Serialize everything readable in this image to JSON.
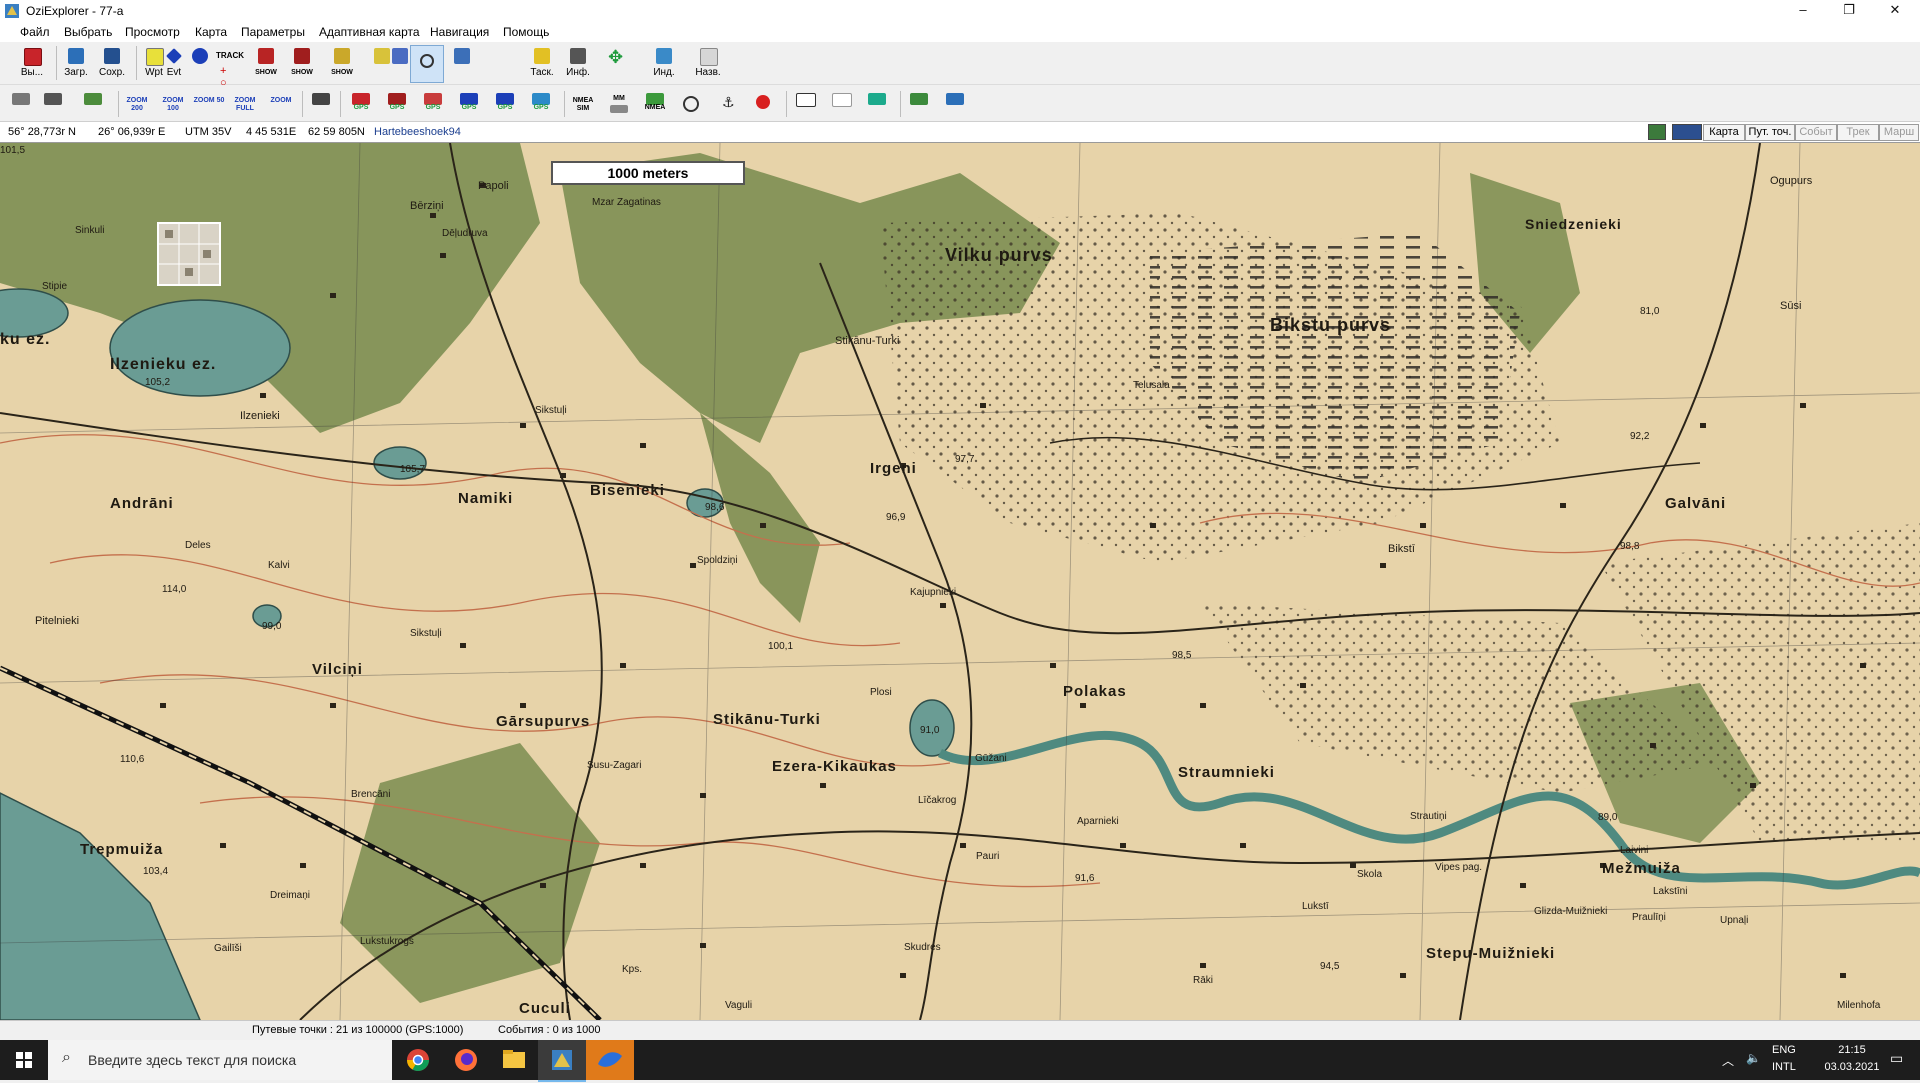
{
  "window": {
    "title": "OziExplorer - 77-a",
    "controls": {
      "minimize": "–",
      "maximize": "❐",
      "close": "✕"
    }
  },
  "menu": [
    "Файл",
    "Выбрать",
    "Просмотр",
    "Карта",
    "Параметры",
    "Адаптивная карта",
    "Навигация",
    "Помощь"
  ],
  "toolbar1": {
    "exit_label": "Вы...",
    "load_label": "Загр.",
    "save_label": "Сохр.",
    "wpt_label": "Wpt",
    "evt_label": "Evt",
    "track_label": "TRACK",
    "show1_label": "SHOW",
    "show2_label": "SHOW",
    "show3_label": "SHOW",
    "zoom_value": "50",
    "task_label": "Таск.",
    "info_label": "Инф.",
    "ind_label": "Инд.",
    "name_label": "Назв."
  },
  "toolbar2": {
    "zoom200": "ZOOM 200",
    "zoom100": "ZOOM 100",
    "zoom50": "ZOOM 50",
    "zoomfull": "ZOOM FULL",
    "zoom": "ZOOM",
    "gps": "GPS",
    "nmea": "NMEA SIM",
    "mm": "MM",
    "nmea2": "NMEA"
  },
  "inforow": {
    "lat": "56° 28,773r N",
    "lon": "26° 06,939r E",
    "utm": "UTM  35V",
    "easting": "4 45 531E",
    "northing": "62 59 805N",
    "datum": "Hartebeeshoek94",
    "tabs": [
      "Карта",
      "Пут. точ.",
      "Событ",
      "Трек",
      "Марш"
    ]
  },
  "map": {
    "scale_label": "1000 meters",
    "labels": [
      {
        "t": "Papoli",
        "s": 11,
        "b": false
      },
      {
        "t": "Mzar Zagatinas",
        "s": 10,
        "b": false
      },
      {
        "t": "Bērziņi",
        "s": 11,
        "b": false
      },
      {
        "t": "Sinkuli",
        "s": 10,
        "b": false
      },
      {
        "t": "Dēļudruva",
        "s": 10,
        "b": false
      },
      {
        "t": "Vilku purvs",
        "s": 18,
        "b": true
      },
      {
        "t": "Sniedzenieki",
        "s": 14,
        "b": true
      },
      {
        "t": "Bikstu purvs",
        "s": 18,
        "b": true
      },
      {
        "t": "Ogupurs",
        "s": 11,
        "b": false
      },
      {
        "t": "Ilzenieku ez.",
        "s": 16,
        "b": true
      },
      {
        "t": "ku ez.",
        "s": 16,
        "b": true
      },
      {
        "t": "Ilzenieki",
        "s": 11,
        "b": false
      },
      {
        "t": "Stikānu-Turki",
        "s": 11,
        "b": false
      },
      {
        "t": "Telusala",
        "s": 10,
        "b": false
      },
      {
        "t": "Sūsi",
        "s": 11,
        "b": false
      },
      {
        "t": "Sikstuļi",
        "s": 10,
        "b": false
      },
      {
        "t": "Irgeni",
        "s": 15,
        "b": true
      },
      {
        "t": "Namiki",
        "s": 15,
        "b": true
      },
      {
        "t": "Bisenieki",
        "s": 15,
        "b": true
      },
      {
        "t": "Andrāni",
        "s": 15,
        "b": true
      },
      {
        "t": "Galvāni",
        "s": 15,
        "b": true
      },
      {
        "t": "Deles",
        "s": 10,
        "b": false
      },
      {
        "t": "Spoldziņi",
        "s": 10,
        "b": false
      },
      {
        "t": "Bikstī",
        "s": 11,
        "b": false
      },
      {
        "t": "Kalvi",
        "s": 10,
        "b": false
      },
      {
        "t": "Kajupnieki",
        "s": 10,
        "b": false
      },
      {
        "t": "Pitelnieki",
        "s": 11,
        "b": false
      },
      {
        "t": "Vilciņi",
        "s": 15,
        "b": true
      },
      {
        "t": "Sikstuļi",
        "s": 10,
        "b": false
      },
      {
        "t": "Polakas",
        "s": 15,
        "b": true
      },
      {
        "t": "Plosi",
        "s": 10,
        "b": false
      },
      {
        "t": "Gārsupurvs",
        "s": 15,
        "b": true
      },
      {
        "t": "Stikānu-Turki",
        "s": 15,
        "b": true
      },
      {
        "t": "Ezera-Kikaukas",
        "s": 15,
        "b": true
      },
      {
        "t": "Straumnieki",
        "s": 15,
        "b": true
      },
      {
        "t": "Susu-Zagari",
        "s": 10,
        "b": false
      },
      {
        "t": "Gūžani",
        "s": 10,
        "b": false
      },
      {
        "t": "Brencāni",
        "s": 10,
        "b": false
      },
      {
        "t": "Līčakrog",
        "s": 10,
        "b": false
      },
      {
        "t": "Aparnieki",
        "s": 10,
        "b": false
      },
      {
        "t": "Strautiņi",
        "s": 10,
        "b": false
      },
      {
        "t": "Mežmuiža",
        "s": 15,
        "b": true
      },
      {
        "t": "Trepmuiža",
        "s": 15,
        "b": true
      },
      {
        "t": "Pauri",
        "s": 10,
        "b": false
      },
      {
        "t": "Vipes pag.",
        "s": 10,
        "b": false
      },
      {
        "t": "Laivini",
        "s": 10,
        "b": false
      },
      {
        "t": "Dreimaņi",
        "s": 10,
        "b": false
      },
      {
        "t": "Skola",
        "s": 10,
        "b": false
      },
      {
        "t": "Lakstīni",
        "s": 10,
        "b": false
      },
      {
        "t": "Lukstī",
        "s": 10,
        "b": false
      },
      {
        "t": "Glizda-Muižnieki",
        "s": 10,
        "b": false
      },
      {
        "t": "Praulīņi",
        "s": 10,
        "b": false
      },
      {
        "t": "Upnaļi",
        "s": 10,
        "b": false
      },
      {
        "t": "Lukstukrogs",
        "s": 10,
        "b": false
      },
      {
        "t": "Skudres",
        "s": 10,
        "b": false
      },
      {
        "t": "Stepu-Muižnieki",
        "s": 15,
        "b": true
      },
      {
        "t": "Gailīši",
        "s": 10,
        "b": false
      },
      {
        "t": "Kps.",
        "s": 10,
        "b": false
      },
      {
        "t": "Rāki",
        "s": 10,
        "b": false
      },
      {
        "t": "Cuculi",
        "s": 15,
        "b": true
      },
      {
        "t": "Vaguli",
        "s": 10,
        "b": false
      },
      {
        "t": "Milenhofa",
        "s": 10,
        "b": false
      },
      {
        "t": "Stipie",
        "s": 10,
        "b": false
      },
      {
        "t": "105,2",
        "s": 10,
        "b": false
      },
      {
        "t": "105,7",
        "s": 10,
        "b": false
      },
      {
        "t": "98,6",
        "s": 10,
        "b": false
      },
      {
        "t": "99,0",
        "s": 10,
        "b": false
      },
      {
        "t": "91,0",
        "s": 10,
        "b": false
      },
      {
        "t": "81,0",
        "s": 10,
        "b": false
      },
      {
        "t": "92,2",
        "s": 10,
        "b": false
      },
      {
        "t": "98,8",
        "s": 10,
        "b": false
      },
      {
        "t": "98,5",
        "s": 10,
        "b": false
      },
      {
        "t": "89,0",
        "s": 10,
        "b": false
      },
      {
        "t": "94,5",
        "s": 10,
        "b": false
      },
      {
        "t": "91,6",
        "s": 10,
        "b": false
      },
      {
        "t": "100,1",
        "s": 10,
        "b": false
      },
      {
        "t": "114,0",
        "s": 10,
        "b": false
      },
      {
        "t": "110,6",
        "s": 10,
        "b": false
      },
      {
        "t": "103,4",
        "s": 10,
        "b": false
      },
      {
        "t": "97,7",
        "s": 10,
        "b": false
      },
      {
        "t": "96,9",
        "s": 10,
        "b": false
      },
      {
        "t": "101,5",
        "s": 10,
        "b": false
      }
    ]
  },
  "status": {
    "waypoints": "Путевые точки : 21 из 100000  (GPS:1000)",
    "events": "События : 0 из 1000"
  },
  "taskbar": {
    "search_placeholder": "Введите здесь текст для поиска",
    "lang1": "ENG",
    "lang2": "INTL",
    "time": "21:15",
    "date": "03.03.2021"
  },
  "colors": {
    "map_paper": "#e8d5ac",
    "forest": "#7d8f52",
    "water": "#6a9c94",
    "contour": "#c4704d",
    "road": "#2a2419"
  }
}
